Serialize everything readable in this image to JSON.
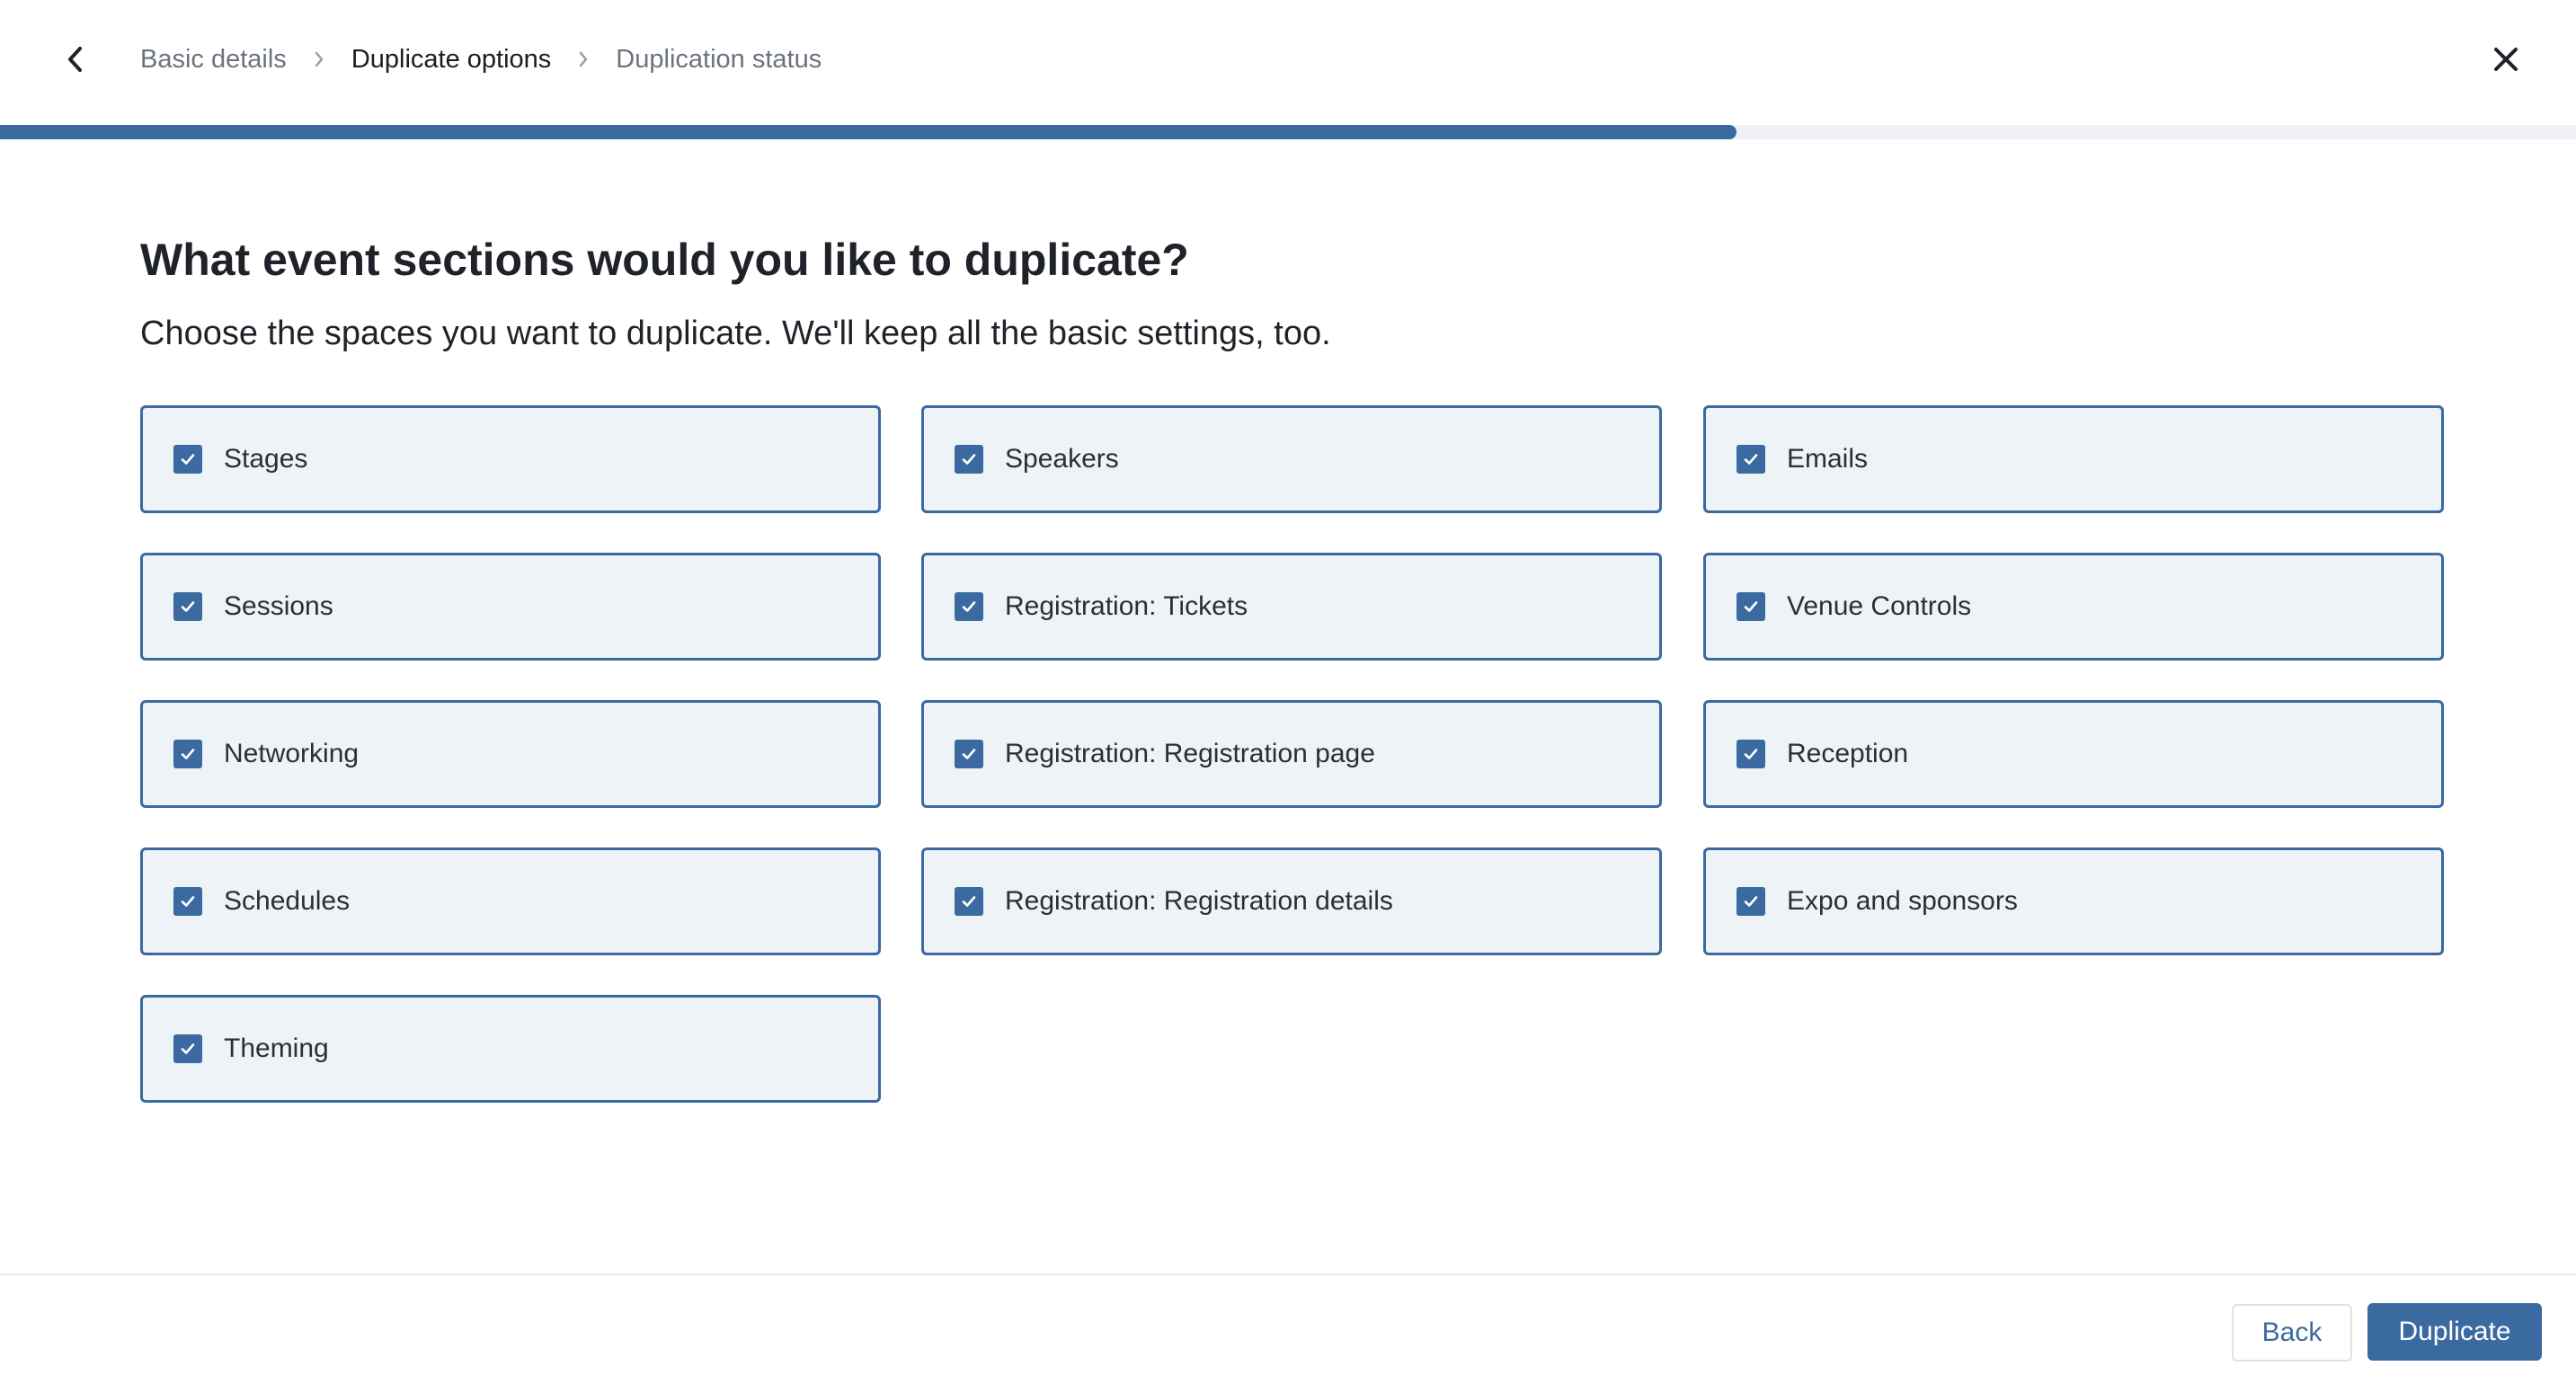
{
  "header": {
    "breadcrumbs": [
      {
        "label": "Basic details",
        "active": false
      },
      {
        "label": "Duplicate options",
        "active": true
      },
      {
        "label": "Duplication status",
        "active": false
      }
    ],
    "back_icon": "chevron-left-icon",
    "close_icon": "close-icon"
  },
  "progress": {
    "percent": 67.4
  },
  "main": {
    "title": "What event sections would you like to duplicate?",
    "subtitle": "Choose the spaces you want to duplicate. We'll keep all the basic settings, too.",
    "options": [
      {
        "label": "Stages",
        "checked": true
      },
      {
        "label": "Speakers",
        "checked": true
      },
      {
        "label": "Emails",
        "checked": true
      },
      {
        "label": "Sessions",
        "checked": true
      },
      {
        "label": "Registration: Tickets",
        "checked": true
      },
      {
        "label": "Venue Controls",
        "checked": true
      },
      {
        "label": "Networking",
        "checked": true
      },
      {
        "label": "Registration: Registration page",
        "checked": true
      },
      {
        "label": "Reception",
        "checked": true
      },
      {
        "label": "Schedules",
        "checked": true
      },
      {
        "label": "Registration: Registration details",
        "checked": true
      },
      {
        "label": "Expo and sponsors",
        "checked": true
      },
      {
        "label": "Theming",
        "checked": true
      }
    ]
  },
  "footer": {
    "back_label": "Back",
    "duplicate_label": "Duplicate"
  },
  "colors": {
    "accent": "#3a6aa0",
    "option_bg": "#eef3f8",
    "track": "#eef0f3"
  }
}
